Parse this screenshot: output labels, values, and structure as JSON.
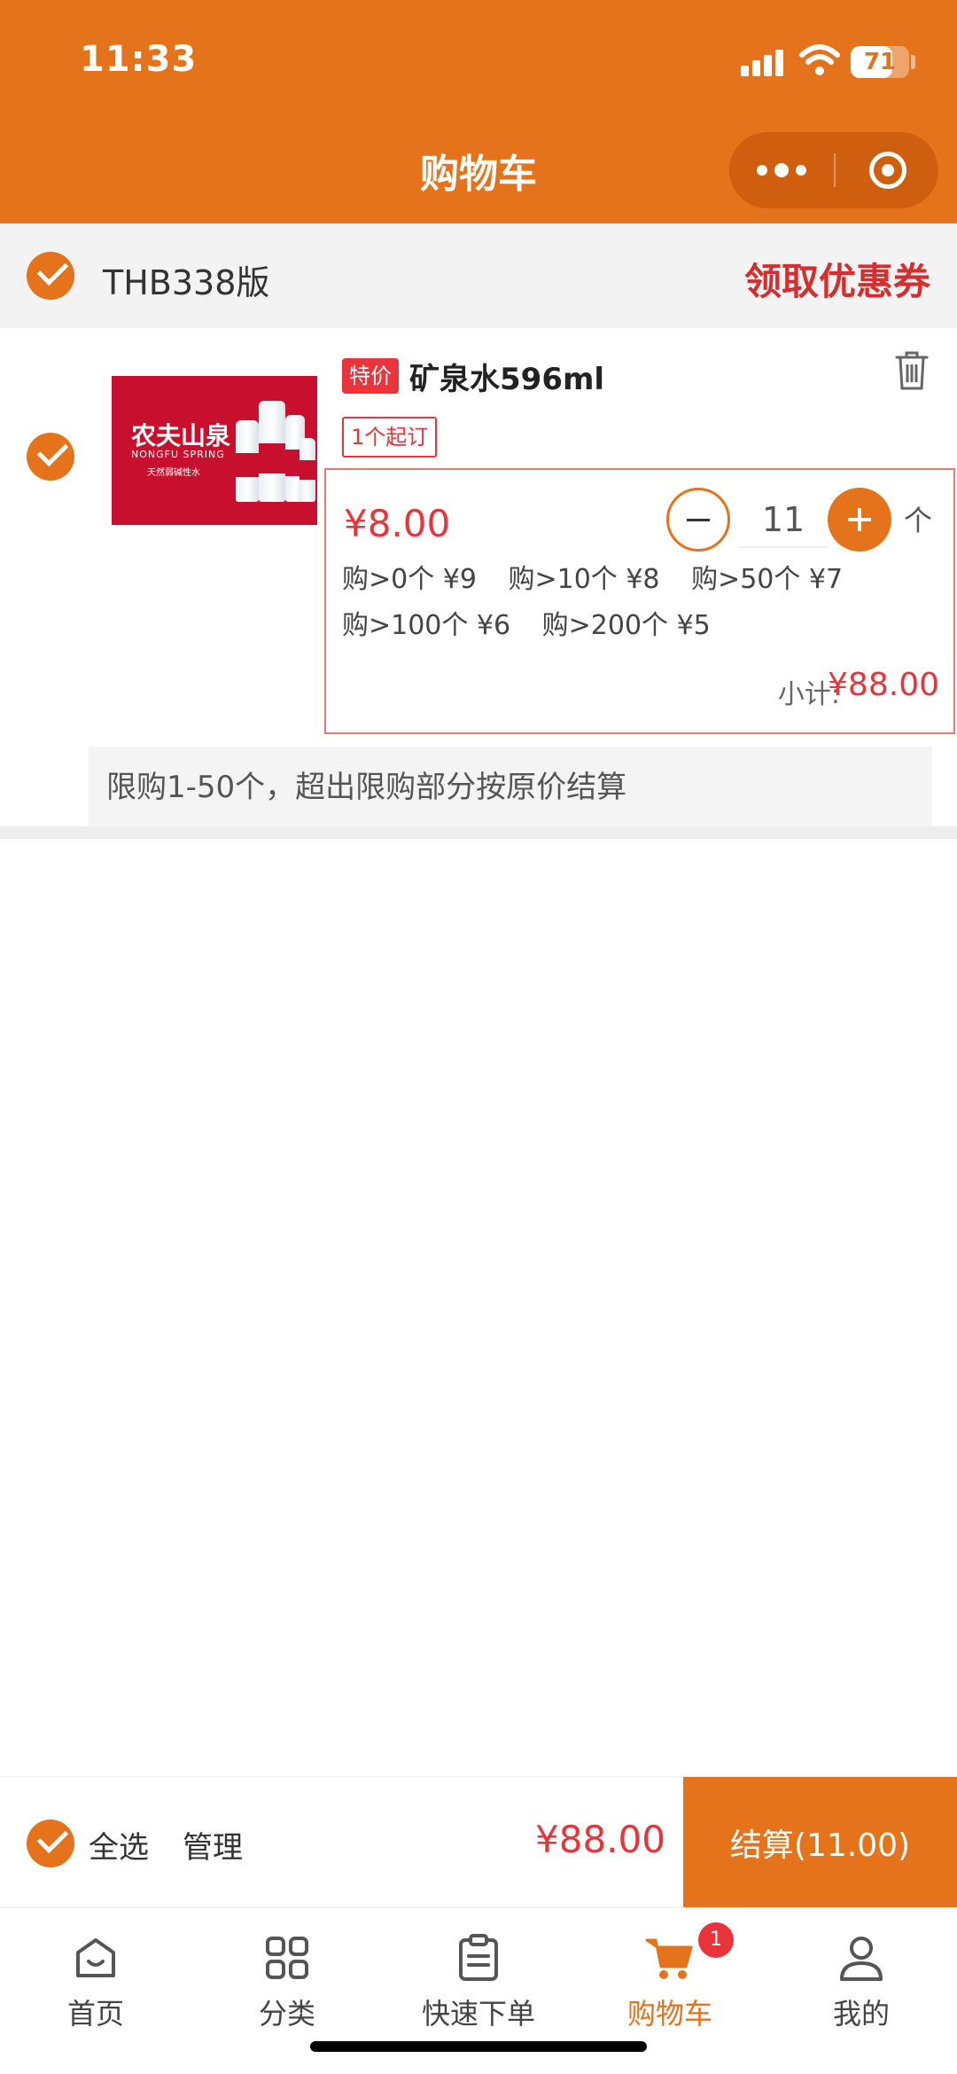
{
  "status_bar": {
    "time": "11:33",
    "battery": "71",
    "battery_level": 0.71
  },
  "header": {
    "title": "购物车",
    "accent_color": "#E5731B"
  },
  "store": {
    "name": "THB338版",
    "coupon_link": "领取优惠券",
    "selected": true
  },
  "product": {
    "selected": true,
    "special_tag": "特价",
    "name": "矿泉水596ml",
    "min_order": "1个起订",
    "image": {
      "brand_cn": "农夫山泉",
      "brand_en": "NONGFU SPRING",
      "brand_sub": "天然弱碱性水"
    },
    "unit_price": "¥8.00",
    "quantity": "11",
    "unit": "个",
    "price_tiers": [
      "购>0个 ¥9",
      "购>10个 ¥8",
      "购>50个 ¥7",
      "购>100个 ¥6",
      "购>200个 ¥5"
    ],
    "subtotal_label": "小计:",
    "subtotal": "¥88.00",
    "limit_note": "限购1-50个，超出限购部分按原价结算"
  },
  "checkout": {
    "select_all_label": "全选",
    "manage_label": "管理",
    "total": "¥88.00",
    "checkout_button": "结算(11.00)"
  },
  "tabbar": {
    "items": [
      {
        "label": "首页",
        "icon": "home-icon"
      },
      {
        "label": "分类",
        "icon": "category-icon"
      },
      {
        "label": "快速下单",
        "icon": "clipboard-icon"
      },
      {
        "label": "购物车",
        "icon": "cart-icon",
        "active": true,
        "badge": "1"
      },
      {
        "label": "我的",
        "icon": "user-icon"
      }
    ]
  }
}
